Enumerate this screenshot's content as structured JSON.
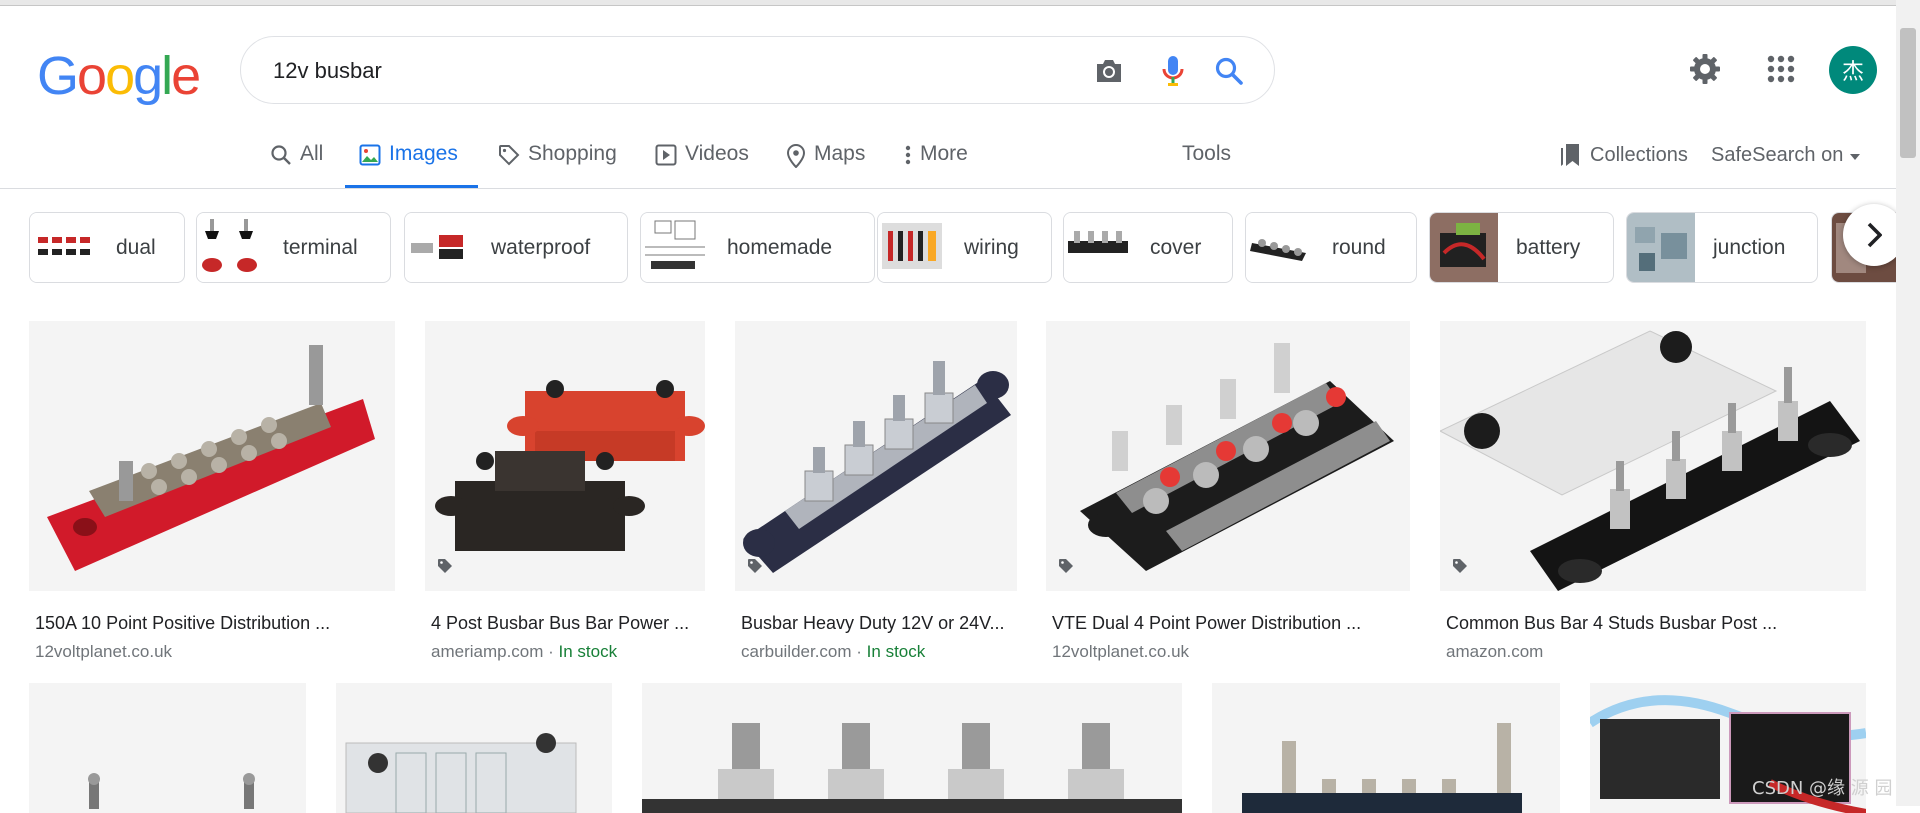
{
  "logo": {
    "letters": [
      "G",
      "o",
      "o",
      "g",
      "l",
      "e"
    ],
    "colors": [
      "#4285f4",
      "#ea4335",
      "#fbbc05",
      "#4285f4",
      "#34a853",
      "#ea4335"
    ]
  },
  "search": {
    "query": "12v busbar"
  },
  "user": {
    "avatar_initial": "杰"
  },
  "tabs": [
    {
      "label": "All",
      "icon": "search-icon"
    },
    {
      "label": "Images",
      "icon": "image-icon"
    },
    {
      "label": "Shopping",
      "icon": "tag-icon"
    },
    {
      "label": "Videos",
      "icon": "play-icon"
    },
    {
      "label": "Maps",
      "icon": "map-pin-icon"
    },
    {
      "label": "More",
      "icon": "more-vert-icon"
    }
  ],
  "active_tab": "Images",
  "tools_label": "Tools",
  "collections_label": "Collections",
  "safesearch_label": "SafeSearch on",
  "chips": [
    {
      "label": "dual"
    },
    {
      "label": "terminal"
    },
    {
      "label": "waterproof"
    },
    {
      "label": "homemade"
    },
    {
      "label": "wiring"
    },
    {
      "label": "cover"
    },
    {
      "label": "round"
    },
    {
      "label": "battery"
    },
    {
      "label": "junction"
    }
  ],
  "results": [
    {
      "title": "150A 10 Point Positive Distribution ...",
      "source": "12voltplanet.co.uk",
      "stock": ""
    },
    {
      "title": "4 Post Busbar Bus Bar Power ...",
      "source": "ameriamp.com",
      "stock": "In stock"
    },
    {
      "title": "Busbar Heavy Duty 12V or 24V...",
      "source": "carbuilder.com",
      "stock": "In stock"
    },
    {
      "title": "VTE Dual 4 Point Power Distribution ...",
      "source": "12voltplanet.co.uk",
      "stock": ""
    },
    {
      "title": "Common Bus Bar 4 Studs Busbar Post ...",
      "source": "amazon.com",
      "stock": ""
    }
  ],
  "watermark": "CSDN @缘 源 园",
  "colors": {
    "accent": "#1a73e8",
    "in_stock": "#188038",
    "avatar_bg": "#00897b"
  }
}
